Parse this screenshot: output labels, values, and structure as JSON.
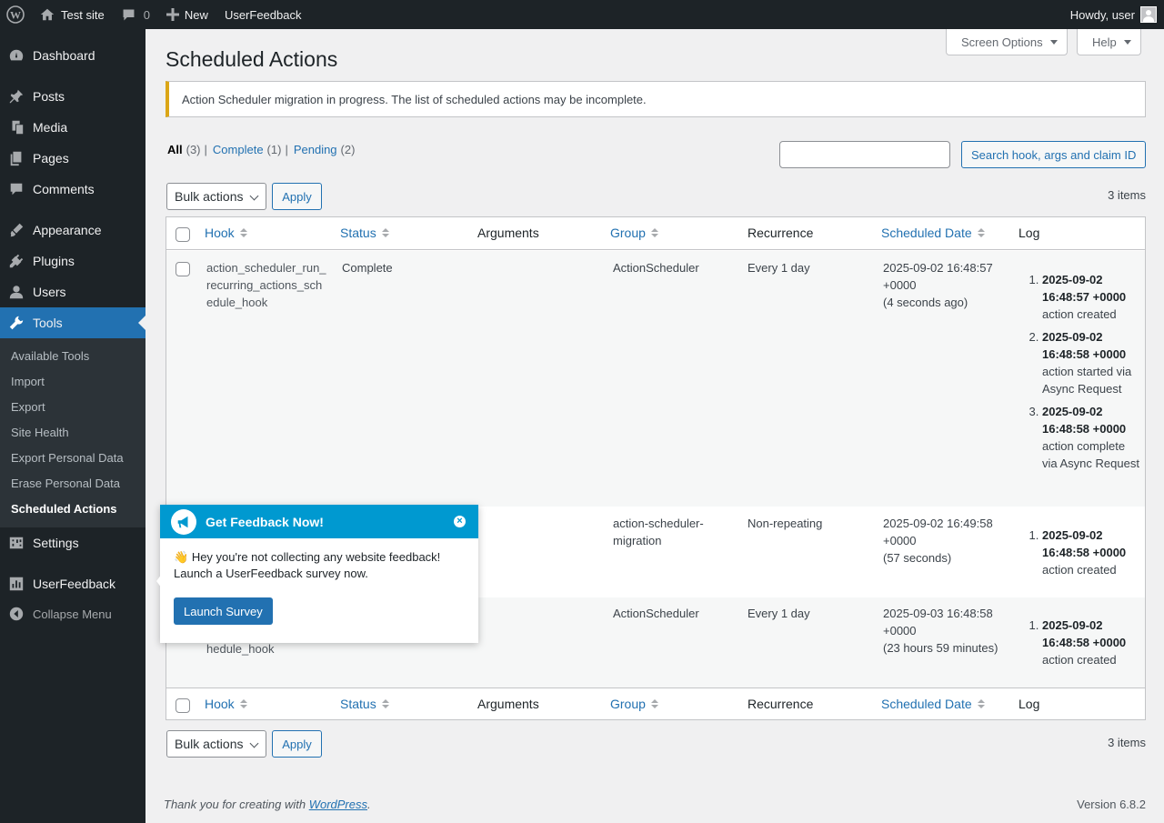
{
  "adminbar": {
    "site_name": "Test site",
    "comments_count": "0",
    "new_label": "New",
    "plugin_label": "UserFeedback",
    "howdy": "Howdy, user"
  },
  "sidebar": {
    "items": [
      {
        "label": "Dashboard",
        "icon": "dashboard-icon"
      },
      {
        "label": "Posts",
        "icon": "pin-icon"
      },
      {
        "label": "Media",
        "icon": "media-icon"
      },
      {
        "label": "Pages",
        "icon": "pages-icon"
      },
      {
        "label": "Comments",
        "icon": "comment-icon"
      },
      {
        "label": "Appearance",
        "icon": "brush-icon"
      },
      {
        "label": "Plugins",
        "icon": "plug-icon"
      },
      {
        "label": "Users",
        "icon": "user-icon"
      },
      {
        "label": "Tools",
        "icon": "wrench-icon"
      },
      {
        "label": "Settings",
        "icon": "settings-icon"
      },
      {
        "label": "UserFeedback",
        "icon": "chart-icon"
      },
      {
        "label": "Collapse Menu",
        "icon": "collapse-icon"
      }
    ],
    "submenu": [
      "Available Tools",
      "Import",
      "Export",
      "Site Health",
      "Export Personal Data",
      "Erase Personal Data",
      "Scheduled Actions"
    ]
  },
  "header": {
    "screen_options": "Screen Options",
    "help": "Help",
    "title": "Scheduled Actions"
  },
  "notice": "Action Scheduler migration in progress. The list of scheduled actions may be incomplete.",
  "filters": {
    "all": "All",
    "all_count": "(3)",
    "complete": "Complete",
    "complete_count": "(1)",
    "pending": "Pending",
    "pending_count": "(2)",
    "sep": "|"
  },
  "search": {
    "button": "Search hook, args and claim ID",
    "value": ""
  },
  "bulk": {
    "select_label": "Bulk actions",
    "apply": "Apply",
    "items": "3 items"
  },
  "table": {
    "columns": {
      "hook": "Hook",
      "status": "Status",
      "arguments": "Arguments",
      "group": "Group",
      "recurrence": "Recurrence",
      "scheduled": "Scheduled Date",
      "log": "Log"
    },
    "rows": [
      {
        "hook": "action_scheduler_run_recurring_actions_schedule_hook",
        "status": "Complete",
        "arguments": "",
        "group": "ActionScheduler",
        "recurrence": "Every 1 day",
        "date": "2025-09-02 16:48:57",
        "tz": "+0000",
        "rel": "(4 seconds ago)",
        "log": [
          {
            "ts1": "2025-09-02",
            "ts2": "16:48:57 +0000",
            "msg": "action created"
          },
          {
            "ts1": "2025-09-02",
            "ts2": "16:48:58 +0000",
            "msg": "action started via Async Request"
          },
          {
            "ts1": "2025-09-02",
            "ts2": "16:48:58 +0000",
            "msg": "action complete via Async Request"
          }
        ]
      },
      {
        "hook": "",
        "status": "",
        "arguments": "",
        "group": "action-scheduler-migration",
        "recurrence": "Non-repeating",
        "date": "2025-09-02 16:49:58",
        "tz": "+0000",
        "rel": "(57 seconds)",
        "log": [
          {
            "ts1": "2025-09-02",
            "ts2": "16:48:58 +0000",
            "msg": "action created"
          }
        ]
      },
      {
        "hook": "hedule_hook",
        "status": "",
        "arguments": "",
        "group": "ActionScheduler",
        "recurrence": "Every 1 day",
        "date": "2025-09-03 16:48:58",
        "tz": "+0000",
        "rel": "(23 hours 59 minutes)",
        "log": [
          {
            "ts1": "2025-09-02",
            "ts2": "16:48:58 +0000",
            "msg": "action created"
          }
        ]
      }
    ]
  },
  "popup": {
    "title": "Get Feedback Now!",
    "emoji": "👋",
    "body": "Hey you're not collecting any website feedback! Launch a UserFeedback survey now.",
    "button": "Launch Survey",
    "close": "×"
  },
  "footer": {
    "thanks_prefix": "Thank you for creating with",
    "wp_link": "WordPress",
    "thanks_suffix": ".",
    "version": "Version 6.8.2"
  },
  "colors": {
    "accent": "#2271b1",
    "sidebar_bg": "#1d2327",
    "notice_warning": "#dba617",
    "popup_header": "#0099d0"
  }
}
